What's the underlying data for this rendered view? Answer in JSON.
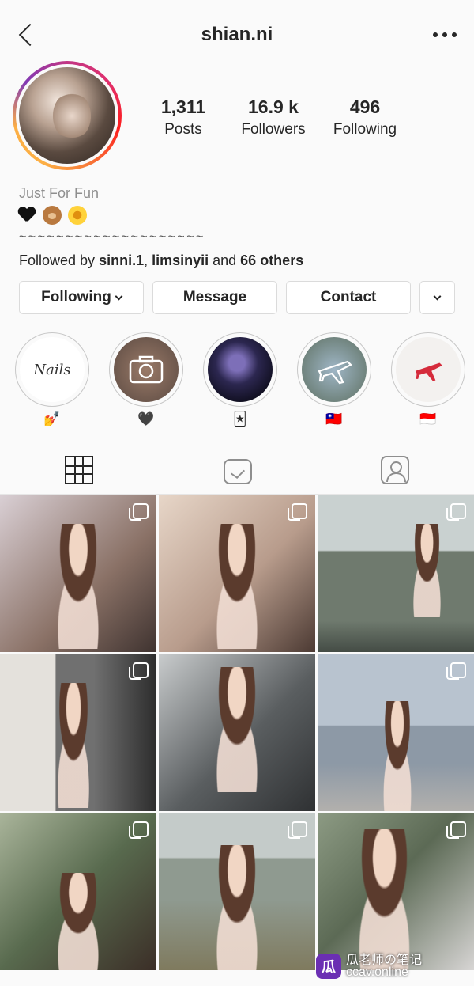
{
  "header": {
    "username": "shian.ni"
  },
  "stats": [
    {
      "value": "1,311",
      "label": "Posts"
    },
    {
      "value": "16.9 k",
      "label": "Followers"
    },
    {
      "value": "496",
      "label": "Following"
    }
  ],
  "bio": {
    "name": "Just For Fun",
    "emojis": [
      "black-heart",
      "teddy-bear",
      "sunflower"
    ],
    "decoration": "~ ~ ~ ~ ~ ~ ~ ~ ~ ~ ~ ~ ~ ~ ~ ~ ~ ~ ~ ~",
    "followed_prefix": "Followed by ",
    "followed_user1": "sinni.1",
    "followed_sep": ", ",
    "followed_user2": "limsinyii",
    "followed_mid": " and ",
    "followed_others": "66 others"
  },
  "actions": {
    "following": "Following",
    "message": "Message",
    "contact": "Contact"
  },
  "highlights": [
    {
      "label": "💅",
      "cover_text": "Nails",
      "icon": "nails-script"
    },
    {
      "label": "🖤",
      "icon": "camera-icon"
    },
    {
      "label": "🃏",
      "icon": "concert-photo"
    },
    {
      "label": "🇹🇼",
      "icon": "airplane-icon"
    },
    {
      "label": "🇮🇩",
      "icon": "airplane-icon"
    }
  ],
  "tabs": [
    "grid",
    "igtv",
    "tagged"
  ],
  "posts": [
    {
      "multi": true,
      "bg": "#8a7166"
    },
    {
      "multi": true,
      "bg": "#b89c8c"
    },
    {
      "multi": true,
      "bg": "#6f7a6e"
    },
    {
      "multi": true,
      "bg": "#707070"
    },
    {
      "multi": false,
      "bg": "#5a5e60"
    },
    {
      "multi": true,
      "bg": "#8d99a6"
    },
    {
      "multi": true,
      "bg": "#586a4e"
    },
    {
      "multi": true,
      "bg": "#8f9a90"
    },
    {
      "multi": true,
      "bg": "#5c6a55"
    }
  ],
  "watermark": {
    "logo": "瓜",
    "title": "瓜老师の笔记",
    "domain": "ccav.online"
  },
  "colors": {
    "accent": "#262626",
    "muted": "#8e8e8e",
    "border": "#dbdbdb"
  }
}
